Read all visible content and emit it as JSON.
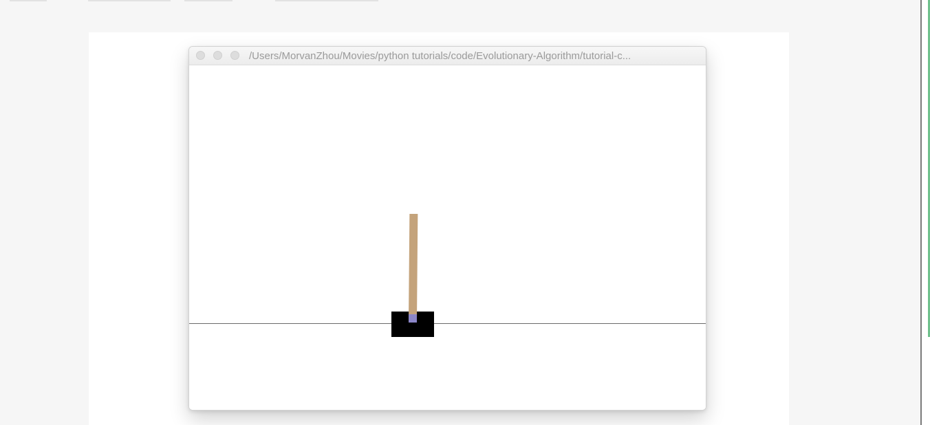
{
  "window": {
    "title": "/Users/MorvanZhou/Movies/python tutorials/code/Evolutionary-Algorithm/tutorial-c..."
  },
  "traffic_lights": {
    "close": "close-button",
    "minimize": "minimize-button",
    "zoom": "zoom-button"
  },
  "colors": {
    "page_background": "#f6f6f6",
    "canvas_background": "#ffffff",
    "cart": "#000000",
    "pole": "#c4a37b",
    "axle": "#8b86c8",
    "track": "#6a6a6a",
    "accent_bar": "#6fc08c"
  },
  "simulation": {
    "name": "cartpole"
  }
}
